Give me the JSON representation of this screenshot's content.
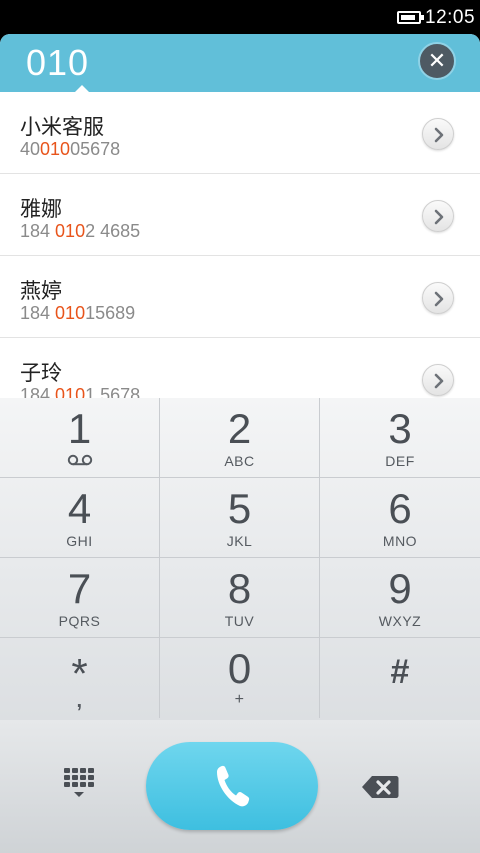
{
  "status_bar": {
    "time": "12:05",
    "battery_level": 0.85,
    "battery_icon": "battery-icon"
  },
  "search": {
    "dialed_number": "010",
    "clear_icon": "close-icon"
  },
  "results": [
    {
      "name": "小米客服",
      "number_parts": [
        "40",
        "010",
        "05678"
      ]
    },
    {
      "name": "雅娜",
      "number_parts": [
        "184 ",
        "010",
        "2 4685"
      ]
    },
    {
      "name": "燕婷",
      "number_parts": [
        "184 ",
        "010",
        "15689"
      ]
    },
    {
      "name": "子玲",
      "number_parts": [
        "184 ",
        "010",
        "1 5678"
      ]
    }
  ],
  "keypad": [
    {
      "digit": "1",
      "letters": "",
      "icon": "voicemail-icon"
    },
    {
      "digit": "2",
      "letters": "ABC"
    },
    {
      "digit": "3",
      "letters": "DEF"
    },
    {
      "digit": "4",
      "letters": "GHI"
    },
    {
      "digit": "5",
      "letters": "JKL"
    },
    {
      "digit": "6",
      "letters": "MNO"
    },
    {
      "digit": "7",
      "letters": "PQRS"
    },
    {
      "digit": "8",
      "letters": "TUV"
    },
    {
      "digit": "9",
      "letters": "WXYZ"
    },
    {
      "digit": "*",
      "letters": ","
    },
    {
      "digit": "0",
      "letters": "+"
    },
    {
      "digit": "#",
      "letters": ""
    }
  ],
  "bottom_bar": {
    "dialpad_icon": "dialpad-grid-icon",
    "call_icon": "phone-icon",
    "delete_icon": "backspace-icon"
  },
  "colors": {
    "header": "#61bfd9",
    "highlight": "#e8541b",
    "call_button": "#4cc6e6"
  }
}
